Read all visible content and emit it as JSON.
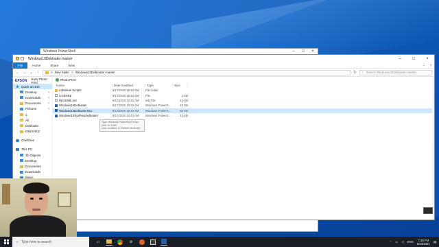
{
  "background_window": {
    "title": "Windows PowerShell"
  },
  "explorer": {
    "title": "Windows10Debloater-master",
    "ribbon_tabs": [
      "File",
      "Home",
      "Share",
      "View"
    ],
    "address_path": [
      ">",
      "New folder",
      ">",
      "Windows10Debloater-master"
    ],
    "search_placeholder": "Search Windows10Debloater-master",
    "toolbar_brand": "EPSON",
    "toolbar_app": "Easy Photo Print",
    "toolbar_photo_print": "Photo Print",
    "columns": [
      "Name",
      "Date modified",
      "Type",
      "Size"
    ],
    "files": [
      {
        "name": "Individual Scripts",
        "date": "8/17/2020 10:43 AM",
        "type": "File folder",
        "size": "",
        "icon": "folder"
      },
      {
        "name": "LICENSE",
        "date": "8/17/2020 10:43 AM",
        "type": "File",
        "size": "2 KB",
        "icon": "doc"
      },
      {
        "name": "README.md",
        "date": "8/17/2020 10:43 AM",
        "type": "MD File",
        "size": "14 KB",
        "icon": "doc"
      },
      {
        "name": "Windows10Debloater",
        "date": "8/17/2020 10:43 AM",
        "type": "Windows PowerS...",
        "size": "43 KB",
        "icon": "ps"
      },
      {
        "name": "Windows10DebloaterGUI",
        "date": "8/17/2020 10:43 AM",
        "type": "Windows PowerS...",
        "size": "63 KB",
        "icon": "ps",
        "selected": true
      },
      {
        "name": "Windows10SysPrepDebloater",
        "date": "8/17/2020 10:43 AM",
        "type": "Windows PowerS...",
        "size": "14 KB",
        "icon": "ps"
      }
    ],
    "tooltip_lines": [
      "Type: Windows PowerShell Script",
      "Size: 62.9 KB",
      "Date modified: 8/17/2020 10:43 AM"
    ],
    "nav": {
      "quick_access": "Quick access",
      "pinned": [
        "Desktop",
        "Downloads",
        "Documents",
        "Pictures"
      ],
      "recent": [
        "1",
        "All",
        "Debloater",
        "FINISHED"
      ],
      "onedrive": "OneDrive",
      "this_pc": "This PC",
      "pc_items": [
        "3D Objects",
        "Desktop",
        "Documents",
        "Downloads",
        "Music"
      ]
    }
  },
  "taskbar": {
    "search_placeholder": "Type here to search",
    "language": "ENG",
    "time": "7:39 PM",
    "date": "5/23/2021"
  }
}
